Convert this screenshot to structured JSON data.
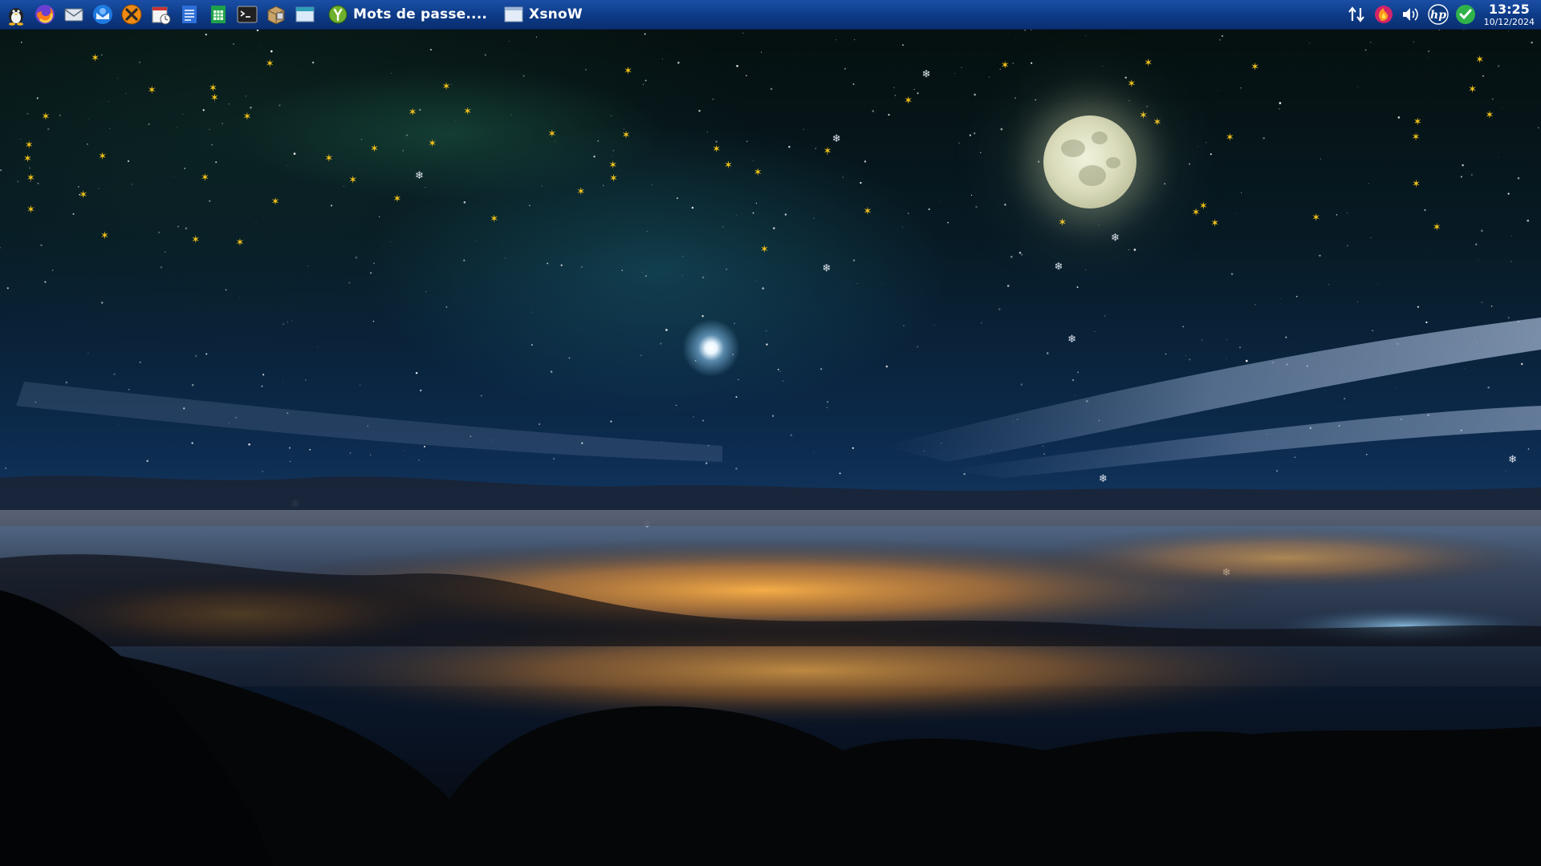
{
  "taskbar": {
    "launchers": [
      {
        "name": "linux-penguin-icon"
      },
      {
        "name": "firefox-icon"
      },
      {
        "name": "mail-icon"
      },
      {
        "name": "thunderbird-icon"
      },
      {
        "name": "xfce-x-icon"
      },
      {
        "name": "calendar-icon"
      },
      {
        "name": "text-document-icon"
      },
      {
        "name": "spreadsheet-icon"
      },
      {
        "name": "terminal-icon"
      },
      {
        "name": "package-manager-icon"
      },
      {
        "name": "window-icon"
      }
    ],
    "tasks": [
      {
        "label": "Mots de passe....",
        "icon": "keepass-icon"
      },
      {
        "label": "XsnoW",
        "icon": "window-icon"
      }
    ],
    "tray": [
      {
        "name": "network-arrows-icon"
      },
      {
        "name": "firefox-red-icon"
      },
      {
        "name": "volume-icon"
      },
      {
        "name": "hp-printer-icon"
      },
      {
        "name": "update-ok-icon"
      }
    ],
    "clock": {
      "time": "13:25",
      "date": "10/12/2024"
    }
  },
  "colors": {
    "taskbar_top": "#1a4fa6",
    "taskbar_bottom": "#0a2f70",
    "star_gold": "#f2c21a",
    "city_glow": "#f0a040"
  }
}
